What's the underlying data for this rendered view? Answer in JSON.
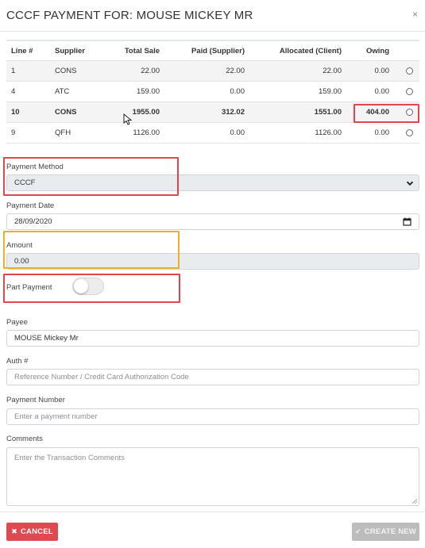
{
  "modal": {
    "title": "CCCF PAYMENT FOR: MOUSE MICKEY MR",
    "close": "×"
  },
  "table": {
    "headers": [
      "Line #",
      "Supplier",
      "Total Sale",
      "Paid (Supplier)",
      "Allocated (Client)",
      "Owing"
    ],
    "rows": [
      {
        "line": "1",
        "supplier": "CONS",
        "total": "22.00",
        "paid": "22.00",
        "allocated": "22.00",
        "owing": "0.00"
      },
      {
        "line": "4",
        "supplier": "ATC",
        "total": "159.00",
        "paid": "0.00",
        "allocated": "159.00",
        "owing": "0.00"
      },
      {
        "line": "10",
        "supplier": "CONS",
        "total": "1955.00",
        "paid": "312.02",
        "allocated": "1551.00",
        "owing": "404.00"
      },
      {
        "line": "9",
        "supplier": "QFH",
        "total": "1126.00",
        "paid": "0.00",
        "allocated": "1126.00",
        "owing": "0.00"
      }
    ]
  },
  "form": {
    "payment_method": {
      "label": "Payment Method",
      "value": "CCCF"
    },
    "payment_date": {
      "label": "Payment Date",
      "value": "28/09/2020"
    },
    "amount": {
      "label": "Amount",
      "value": "0.00"
    },
    "part_payment": {
      "label": "Part Payment",
      "checked": false
    },
    "payee": {
      "label": "Payee",
      "value": "MOUSE Mickey Mr"
    },
    "auth": {
      "label": "Auth #",
      "placeholder": "Reference Number / Credit Card Authorization Code"
    },
    "payment_number": {
      "label": "Payment Number",
      "placeholder": "Enter a payment number"
    },
    "comments": {
      "label": "Comments",
      "placeholder": "Enter the Transaction Comments"
    }
  },
  "footer": {
    "cancel_label": "CANCEL",
    "create_label": "CREATE NEW"
  },
  "colors": {
    "highlight_red": "#e0464b",
    "highlight_orange": "#f0ad27",
    "cancel_button": "#de4a4f",
    "create_button_disabled": "#bcbcbc"
  },
  "icons": {
    "close": "close-icon",
    "calendar": "calendar-icon",
    "select": "chevron-down-icon",
    "cancel": "times-icon",
    "create": "check-icon"
  }
}
